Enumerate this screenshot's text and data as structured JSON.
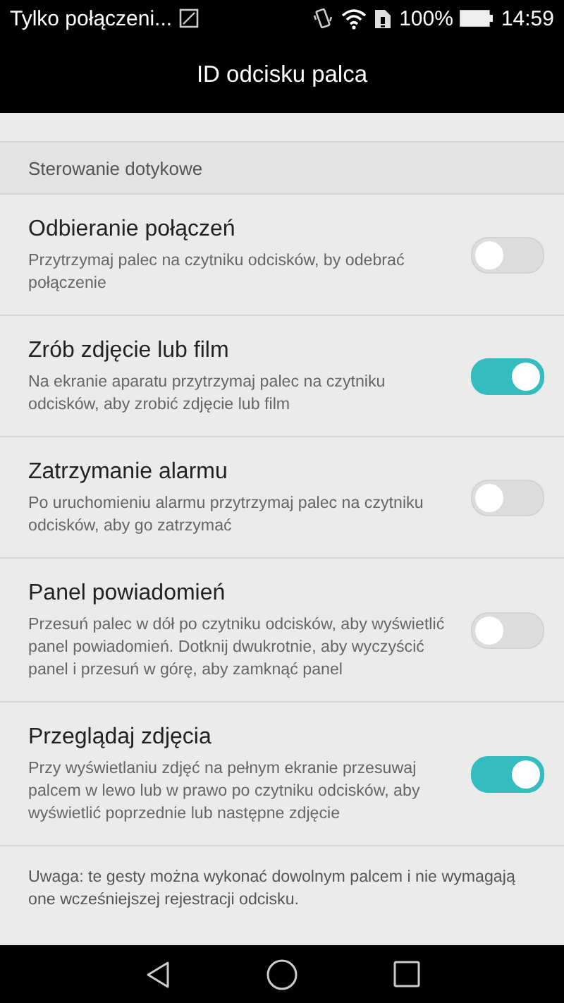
{
  "status_bar": {
    "notification": "Tylko połączeni...",
    "battery": "100%",
    "time": "14:59"
  },
  "title": "ID odcisku palca",
  "section": {
    "label": "Sterowanie dotykowe"
  },
  "settings": [
    {
      "title": "Odbieranie połączeń",
      "description": "Przytrzymaj palec na czytniku odcisków, by odebrać połączenie",
      "on": false
    },
    {
      "title": "Zrób zdjęcie lub film",
      "description": "Na ekranie aparatu przytrzymaj palec na czytniku odcisków, aby zrobić zdjęcie lub film",
      "on": true
    },
    {
      "title": "Zatrzymanie alarmu",
      "description": "Po uruchomieniu alarmu przytrzymaj palec na czytniku odcisków, aby go zatrzymać",
      "on": false
    },
    {
      "title": "Panel powiadomień",
      "description": "Przesuń palec w dół po czytniku odcisków, aby wyświetlić panel powiadomień. Dotknij dwukrotnie, aby wyczyścić panel i przesuń w górę, aby zamknąć panel",
      "on": false
    },
    {
      "title": "Przeglądaj zdjęcia",
      "description": "Przy wyświetlaniu zdjęć na pełnym ekranie przesuwaj palcem w lewo lub w prawo po czytniku odcisków, aby wyświetlić poprzednie lub następne zdjęcie",
      "on": true
    }
  ],
  "footer_note": "Uwaga: te gesty można wykonać dowolnym palcem i nie wymagają one wcześniejszej rejestracji odcisku."
}
